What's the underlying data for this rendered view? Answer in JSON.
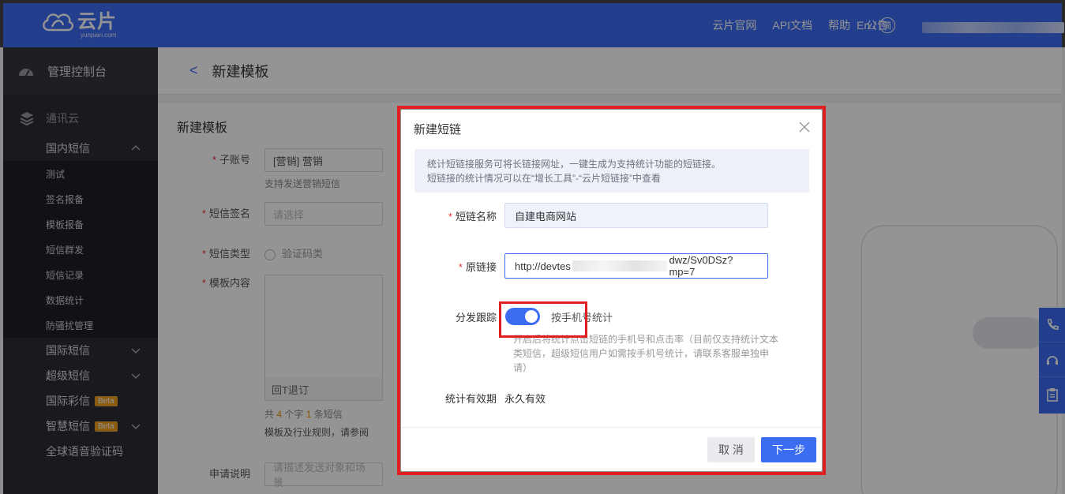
{
  "header": {
    "brand": "云片",
    "brand_sub": "yunpian.com",
    "nav": [
      "云片官网",
      "API文档",
      "帮助",
      "公告"
    ],
    "lang": "En /",
    "lang_alt": "简"
  },
  "sidebar": {
    "dashboard": "管理控制台",
    "group": "通讯云",
    "domestic_sms": "国内短信",
    "children": [
      "测试",
      "签名报备",
      "模板报备",
      "短信群发",
      "短信记录",
      "数据统计",
      "防骚扰管理"
    ],
    "items": [
      {
        "label": "国际短信",
        "chevron": true,
        "beta": ""
      },
      {
        "label": "超级短信",
        "chevron": true,
        "beta": ""
      },
      {
        "label": "国际彩信",
        "chevron": false,
        "beta": "Beta"
      },
      {
        "label": "智慧短信",
        "chevron": true,
        "beta": "Beta"
      },
      {
        "label": "全球语音验证码",
        "chevron": false,
        "beta": ""
      }
    ]
  },
  "main": {
    "page_title": "新建模板",
    "card_title": "新建模板",
    "form": {
      "subaccount_label": "子账号",
      "subaccount_value": "[营销] 营销",
      "subaccount_hint": "支持发送营销短信",
      "signature_label": "短信签名",
      "signature_placeholder": "请选择",
      "type_label": "短信类型",
      "type_option": "验证码类",
      "content_label": "模板内容",
      "unsubscribe": "回T退订",
      "count_prefix": "共",
      "count_chars": "4",
      "count_mid": "个字",
      "count_msgs": "1",
      "count_suffix": "条短信",
      "rules_hint": "模板及行业规则，请参阅",
      "desc_label": "申请说明",
      "desc_placeholder": "请描述发送对象和场景"
    }
  },
  "modal": {
    "title": "新建短链",
    "info_line1": "统计短链接服务可将长链接网址，一键生成为支持统计功能的短链接。",
    "info_line2": "短链接的统计情况可以在“增长工具”-“云片短链接”中查看",
    "name_label": "短链名称",
    "name_value": "自建电商网站",
    "url_label": "原链接",
    "url_start": "http://devtes",
    "url_end": "dwz/Sv0DSz?mp=7",
    "tracking_label": "分发跟踪",
    "tracking_option": "按手机号统计",
    "tracking_on": true,
    "tracking_desc": "开启后将统计点击短链的手机号和点击率（目前仅支持统计文本类短信，超级短信用户如需按手机号统计，请联系客服单独申请）",
    "validity_label": "统计有效期",
    "validity_value": "永久有效",
    "cancel": "取 消",
    "next": "下一步"
  },
  "colors": {
    "primary": "#3b6cf2",
    "sidebar_bg": "#2b2d36",
    "highlight": "#e02020"
  }
}
